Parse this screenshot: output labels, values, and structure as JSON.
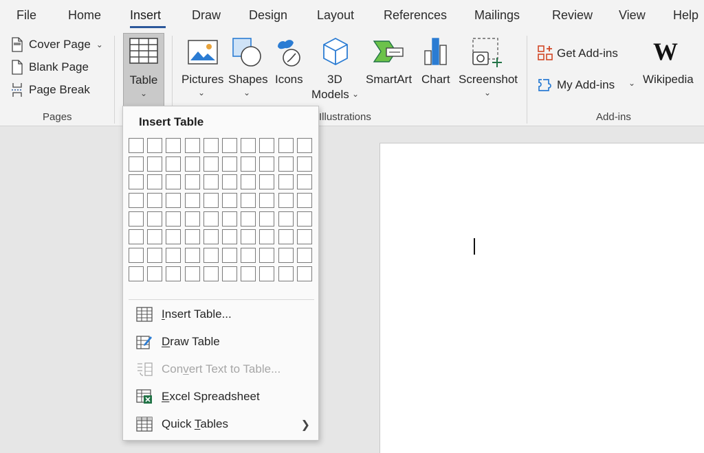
{
  "menu": {
    "tabs": [
      "File",
      "Home",
      "Insert",
      "Draw",
      "Design",
      "Layout",
      "References",
      "Mailings",
      "Review",
      "View",
      "Help"
    ],
    "active": "Insert"
  },
  "ribbon": {
    "pages": {
      "items": [
        "Cover Page",
        "Blank Page",
        "Page Break"
      ],
      "group_label": "Pages"
    },
    "table": {
      "label": "Table"
    },
    "illustrations": {
      "pictures": "Pictures",
      "shapes": "Shapes",
      "icons": "Icons",
      "models_line1": "3D",
      "models_line2": "Models",
      "smartart": "SmartArt",
      "chart": "Chart",
      "screenshot": "Screenshot",
      "group_label": "Illustrations"
    },
    "addins": {
      "get": "Get Add-ins",
      "my": "My Add-ins",
      "wikipedia": "Wikipedia",
      "wiki_logo": "W",
      "group_label": "Add-ins"
    }
  },
  "dropdown": {
    "title": "Insert Table",
    "grid": {
      "rows": 8,
      "cols": 10
    },
    "items": [
      {
        "pre": "",
        "u": "I",
        "post": "nsert Table...",
        "disabled": false,
        "icon": "table-grid-icon"
      },
      {
        "pre": "",
        "u": "D",
        "post": "raw Table",
        "disabled": false,
        "icon": "draw-table-icon"
      },
      {
        "pre": "Con",
        "u": "v",
        "post": "ert Text to Table...",
        "disabled": true,
        "icon": "convert-text-icon"
      },
      {
        "pre": "",
        "u": "E",
        "post": "xcel Spreadsheet",
        "disabled": false,
        "icon": "excel-spreadsheet-icon"
      },
      {
        "pre": "Quick ",
        "u": "T",
        "post": "ables",
        "disabled": false,
        "icon": "quick-tables-icon"
      }
    ]
  },
  "colors": {
    "accent": "#2b579a",
    "excel_green": "#217346",
    "addin_orange": "#d24726",
    "ribbon_bg": "#f3f3f3",
    "selected_button": "#c9c9c9"
  }
}
